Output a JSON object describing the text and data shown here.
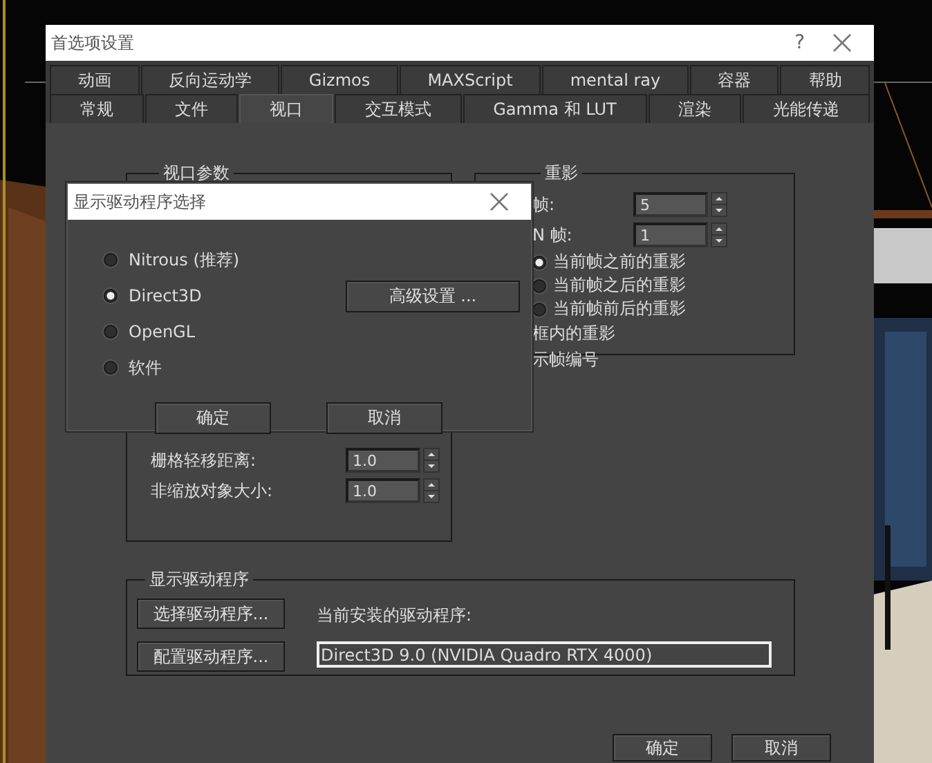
{
  "preferences_window": {
    "title": "首选项设置",
    "help_button": "?",
    "tab_rows": [
      [
        {
          "label": "动画",
          "selected": false
        },
        {
          "label": "反向运动学",
          "selected": false
        },
        {
          "label": "Gizmos",
          "selected": false
        },
        {
          "label": "MAXScript",
          "selected": false
        },
        {
          "label": "mental ray",
          "selected": false
        },
        {
          "label": "容器",
          "selected": false
        },
        {
          "label": "帮助",
          "selected": false
        }
      ],
      [
        {
          "label": "常规",
          "selected": false
        },
        {
          "label": "文件",
          "selected": false
        },
        {
          "label": "视口",
          "selected": true
        },
        {
          "label": "交互模式",
          "selected": false
        },
        {
          "label": "Gamma 和 LUT",
          "selected": false
        },
        {
          "label": "渲染",
          "selected": false
        },
        {
          "label": "光能传递",
          "selected": false
        }
      ]
    ],
    "viewport_group": {
      "title": "视口参数",
      "fields": [
        {
          "label": "栅格轻移距离:",
          "value": "1.0"
        },
        {
          "label": "非缩放对象大小:",
          "value": "1.0"
        }
      ]
    },
    "ghosting_group": {
      "title": "重影",
      "fields": [
        {
          "label": "帧:",
          "value": "5"
        },
        {
          "label": "N 帧:",
          "value": "1"
        }
      ],
      "options": [
        {
          "label": "当前帧之前的重影",
          "selected": true
        },
        {
          "label": "当前帧之后的重影",
          "selected": false
        },
        {
          "label": "当前帧前后的重影",
          "selected": false
        }
      ],
      "items": [
        "框内的重影",
        "示帧编号"
      ]
    },
    "driver_group": {
      "title": "显示驱动程序",
      "buttons": [
        "选择驱动程序...",
        "配置驱动程序..."
      ],
      "current_label": "当前安装的驱动程序:",
      "current_value": "Direct3D 9.0 (NVIDIA Quadro RTX 4000)"
    },
    "buttons": [
      "确定",
      "取消"
    ]
  },
  "driver_dialog": {
    "title": "显示驱动程序选择",
    "options": [
      {
        "label": "Nitrous (推荐)",
        "selected": false
      },
      {
        "label": "Direct3D",
        "selected": true
      },
      {
        "label": "OpenGL",
        "selected": false
      },
      {
        "label": "软件",
        "selected": false
      }
    ],
    "advanced_button": "高级设置 ...",
    "buttons": [
      "确定",
      "取消"
    ]
  }
}
